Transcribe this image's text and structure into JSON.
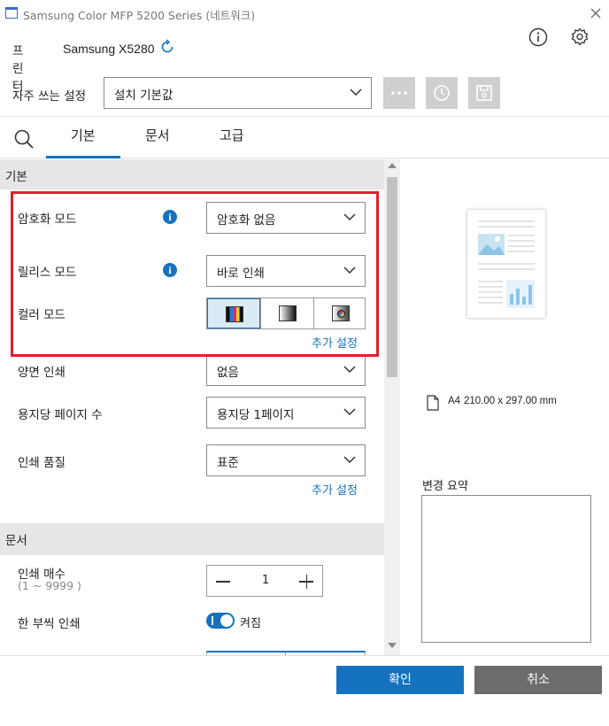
{
  "window": {
    "title": "Samsung Color MFP 5200 Series (네트워크)"
  },
  "printer": {
    "label": "프린터",
    "name": "Samsung X5280"
  },
  "presets": {
    "label": "자주 쓰는 설정",
    "value": "설치 기본값"
  },
  "tabs": [
    {
      "label": "기본",
      "selected": true
    },
    {
      "label": "문서",
      "selected": false
    },
    {
      "label": "고급",
      "selected": false
    }
  ],
  "basic": {
    "header": "기본",
    "encryption": {
      "label": "암호화 모드",
      "value": "암호화 없음"
    },
    "release": {
      "label": "릴리스 모드",
      "value": "바로 인쇄"
    },
    "color": {
      "label": "컬러 모드",
      "options": [
        "color",
        "grayscale",
        "auto"
      ],
      "selected": "color"
    },
    "more_settings_1": "추가 설정",
    "duplex": {
      "label": "양면 인쇄",
      "value": "없음"
    },
    "pages_per_sheet": {
      "label": "용지당 페이지 수",
      "value": "용지당 1페이지"
    },
    "quality": {
      "label": "인쇄 품질",
      "value": "표준"
    },
    "more_settings_2": "추가 설정"
  },
  "document": {
    "header": "문서",
    "copies": {
      "label": "인쇄 매수",
      "range": "(1 ~ 9999 )",
      "value": "1"
    },
    "collate": {
      "label": "한 부씩 인쇄",
      "state": "켜짐",
      "on": true
    }
  },
  "preview": {
    "paper": "A4",
    "dimensions": "210.00 x 297.00  mm",
    "summary_label": "변경 요약"
  },
  "footer": {
    "ok": "확인",
    "cancel": "취소"
  },
  "colors": {
    "accent": "#1572bf",
    "highlight": "#e0202c",
    "cancel": "#6c6c6c"
  }
}
